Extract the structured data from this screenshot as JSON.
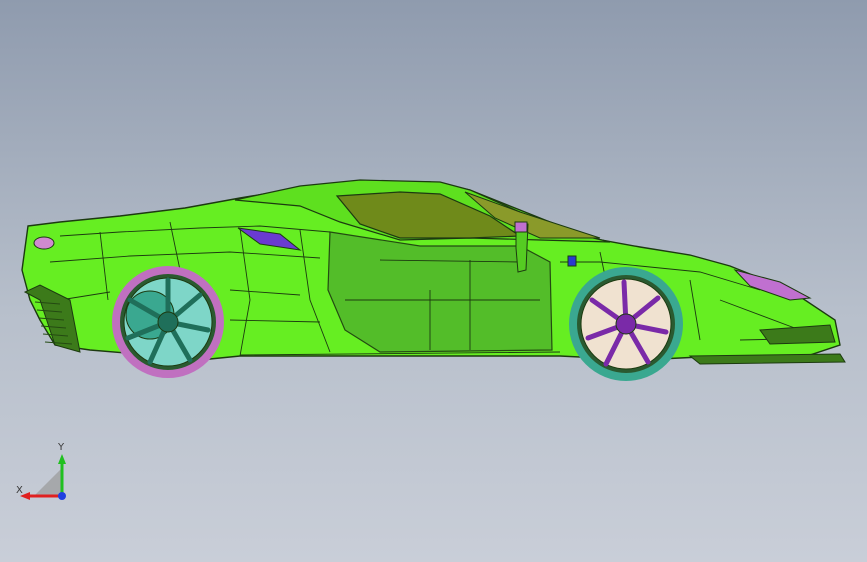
{
  "viewport": {
    "background_top": "#8f9bae",
    "background_bottom": "#c9ced8"
  },
  "model": {
    "body_color": "#66ee22",
    "glass_color": "#6f8a1a",
    "wheel_front_spokes_color": "#7a2aa8",
    "wheel_rear_spokes_color": "#1f6f5a",
    "tire_rear_color": "#c070c0",
    "tire_front_color": "#3aa890",
    "accent_color": "#6a3ad0"
  },
  "triad": {
    "x_label": "X",
    "y_label": "Y",
    "x_color": "#e02020",
    "y_color": "#20c020",
    "z_color": "#2040e0"
  }
}
